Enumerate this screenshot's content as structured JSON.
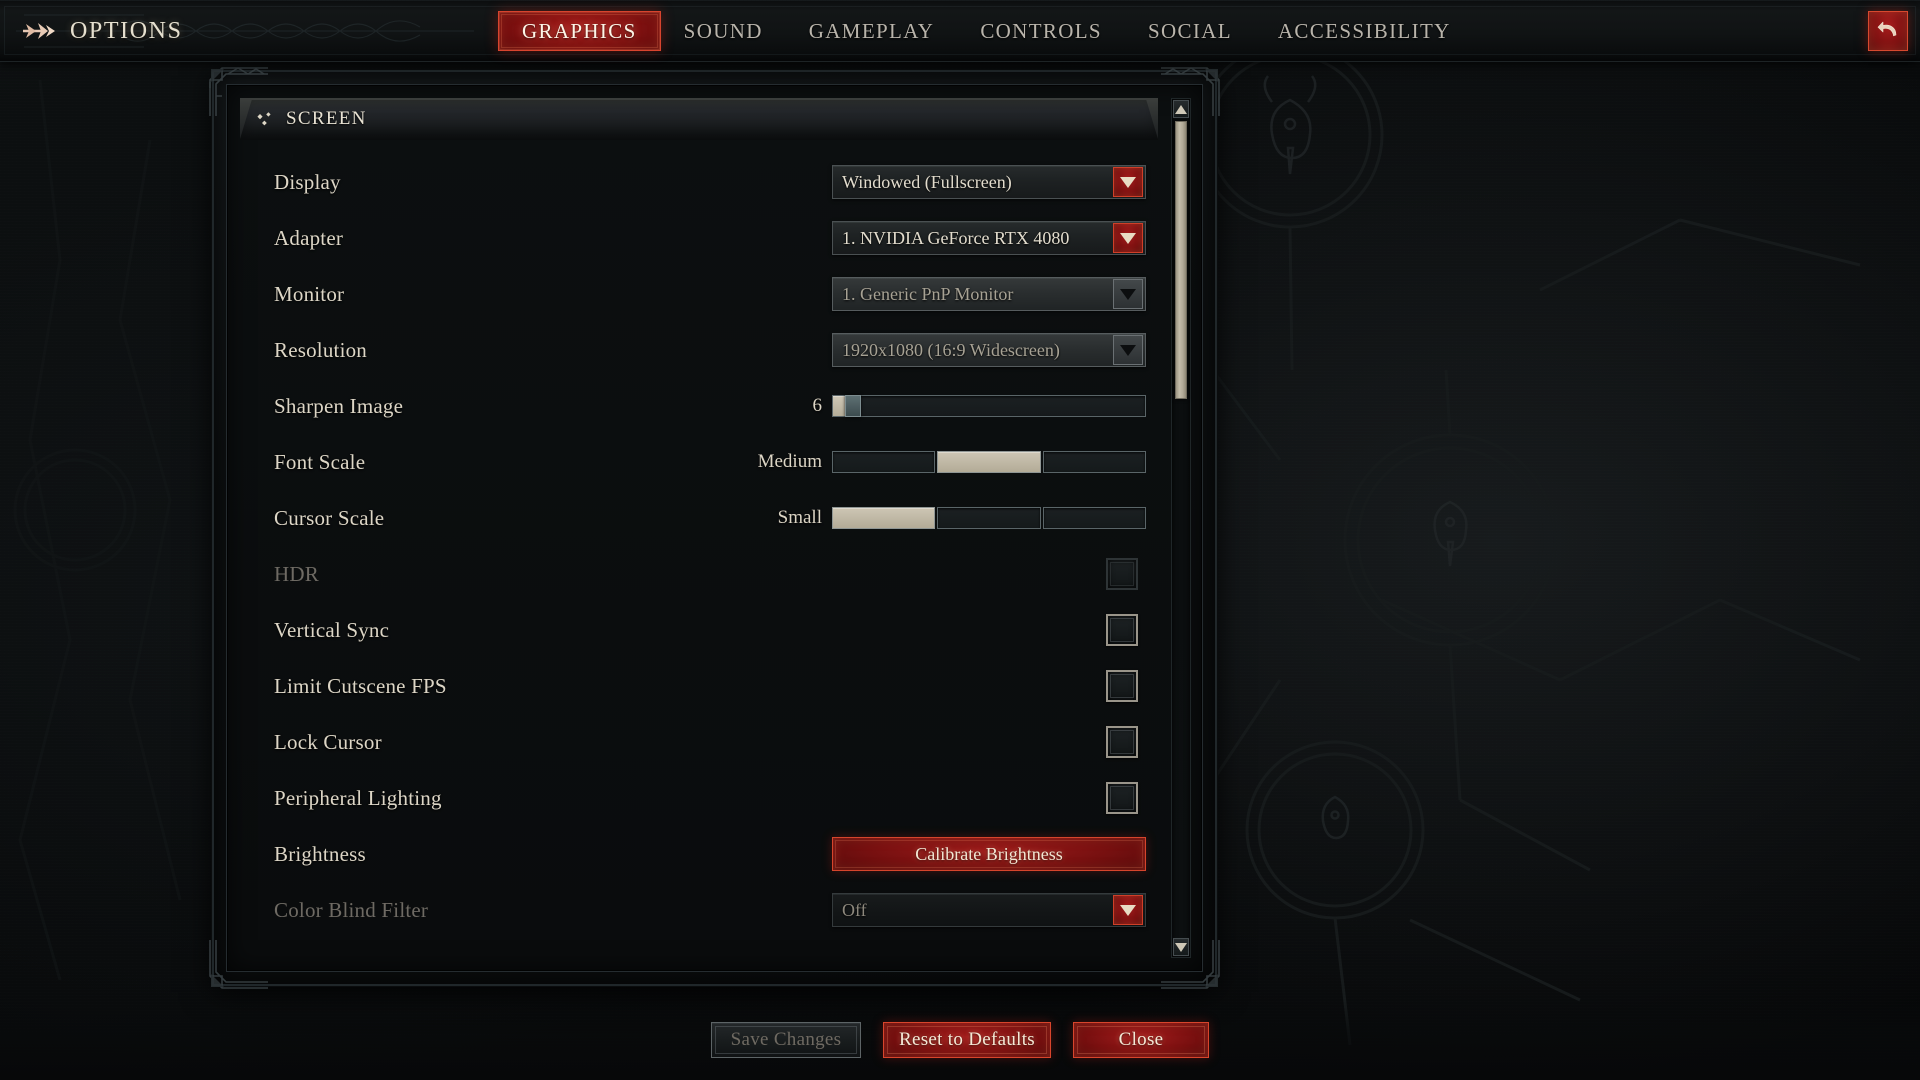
{
  "header": {
    "title": "OPTIONS",
    "menu_icon": "double-arrow-icon",
    "back_icon": "back-arrow-icon",
    "tabs": [
      {
        "label": "GRAPHICS",
        "active": true
      },
      {
        "label": "SOUND",
        "active": false
      },
      {
        "label": "GAMEPLAY",
        "active": false
      },
      {
        "label": "CONTROLS",
        "active": false
      },
      {
        "label": "SOCIAL",
        "active": false
      },
      {
        "label": "ACCESSIBILITY",
        "active": false
      }
    ]
  },
  "panel": {
    "section_title": "SCREEN",
    "section_icon": "diamond-cluster-icon",
    "rows": [
      {
        "label": "Display",
        "type": "dropdown",
        "value": "Windowed (Fullscreen)",
        "state": "enabled"
      },
      {
        "label": "Adapter",
        "type": "dropdown",
        "value": "1. NVIDIA GeForce RTX 4080",
        "state": "enabled"
      },
      {
        "label": "Monitor",
        "type": "dropdown",
        "value": "1. Generic PnP Monitor",
        "state": "disabled"
      },
      {
        "label": "Resolution",
        "type": "dropdown",
        "value": "1920x1080 (16:9 Widescreen)",
        "state": "disabled"
      },
      {
        "label": "Sharpen Image",
        "type": "slider",
        "value": "6",
        "fill_percent": 4,
        "state": "enabled"
      },
      {
        "label": "Font Scale",
        "type": "segmented",
        "value": "Medium",
        "segments": 3,
        "selected_index": 1,
        "state": "enabled"
      },
      {
        "label": "Cursor Scale",
        "type": "segmented",
        "value": "Small",
        "segments": 3,
        "selected_index": 0,
        "state": "enabled"
      },
      {
        "label": "HDR",
        "type": "checkbox",
        "checked": false,
        "state": "disabled"
      },
      {
        "label": "Vertical Sync",
        "type": "checkbox",
        "checked": false,
        "state": "enabled"
      },
      {
        "label": "Limit Cutscene FPS",
        "type": "checkbox",
        "checked": false,
        "state": "enabled"
      },
      {
        "label": "Lock Cursor",
        "type": "checkbox",
        "checked": false,
        "state": "enabled"
      },
      {
        "label": "Peripheral Lighting",
        "type": "checkbox",
        "checked": false,
        "state": "enabled"
      },
      {
        "label": "Brightness",
        "type": "button",
        "value": "Calibrate Brightness",
        "state": "enabled"
      },
      {
        "label": "Color Blind Filter",
        "type": "dropdown",
        "value": "Off",
        "state": "dim"
      }
    ]
  },
  "scrollbar": {
    "up_icon": "scroll-up-arrow-icon",
    "down_icon": "scroll-down-arrow-icon",
    "thumb_position_percent": 0,
    "thumb_size_percent": 32
  },
  "footer": {
    "buttons": [
      {
        "label": "Save Changes",
        "style": "ghost"
      },
      {
        "label": "Reset to Defaults",
        "style": "danger"
      },
      {
        "label": "Close",
        "style": "danger"
      }
    ]
  },
  "colors": {
    "accent_red": "#a31818",
    "accent_red_border": "#d8442e",
    "text_primary": "#e2dccd",
    "text_disabled": "#6e6a63",
    "slider_fill": "#cfc8b6",
    "panel_bg": "#0c0f10"
  }
}
